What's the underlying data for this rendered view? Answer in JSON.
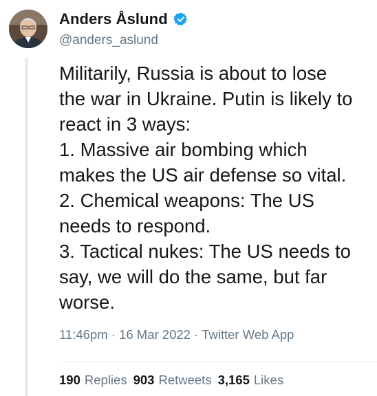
{
  "author": {
    "display_name": "Anders Åslund",
    "handle": "@anders_aslund",
    "verified": true,
    "verified_color": "#1da1f2"
  },
  "tweet": {
    "lines": [
      "Militarily, Russia is about to lose",
      "the war in Ukraine. Putin is likely to",
      "react in 3 ways:",
      "1. Massive air bombing which",
      "makes the US air defense so vital.",
      "2. Chemical weapons: The US",
      "needs to respond.",
      "3. Tactical nukes: The US needs to",
      "say, we will do the same, but far",
      "worse."
    ]
  },
  "meta": {
    "time": "11:46pm",
    "separator1": "·",
    "date": "16 Mar 2022",
    "separator2": "·",
    "source": "Twitter Web App"
  },
  "stats": {
    "replies_count": "190",
    "replies_label": "Replies",
    "retweets_count": "903",
    "retweets_label": "Retweets",
    "likes_count": "3,165",
    "likes_label": "Likes"
  },
  "icons": {
    "verified": "verified-badge-icon",
    "avatar": "profile-photo"
  }
}
